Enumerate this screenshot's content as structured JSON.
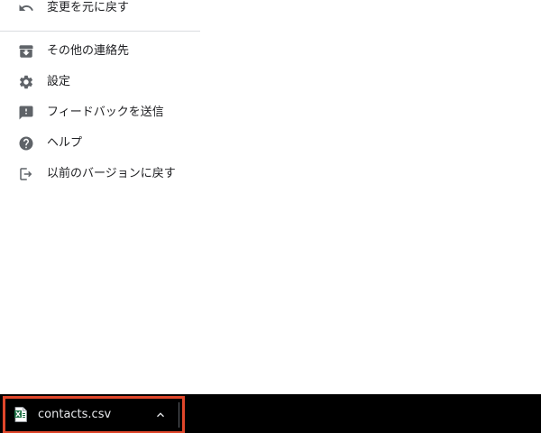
{
  "menu": {
    "items": [
      {
        "label": "変更を元に戻す",
        "icon": "undo-icon"
      },
      {
        "label": "その他の連絡先",
        "icon": "archive-icon"
      },
      {
        "label": "設定",
        "icon": "gear-icon"
      },
      {
        "label": "フィードバックを送信",
        "icon": "feedback-icon"
      },
      {
        "label": "ヘルプ",
        "icon": "help-icon"
      },
      {
        "label": "以前のバージョンに戻す",
        "icon": "exit-icon"
      }
    ]
  },
  "download_bar": {
    "file_name": "contacts.csv",
    "file_icon": "excel-file-icon",
    "highlight_color": "#e0472b"
  },
  "colors": {
    "icon_gray": "#5f6368",
    "text": "#202124",
    "bar_bg": "#000000"
  }
}
